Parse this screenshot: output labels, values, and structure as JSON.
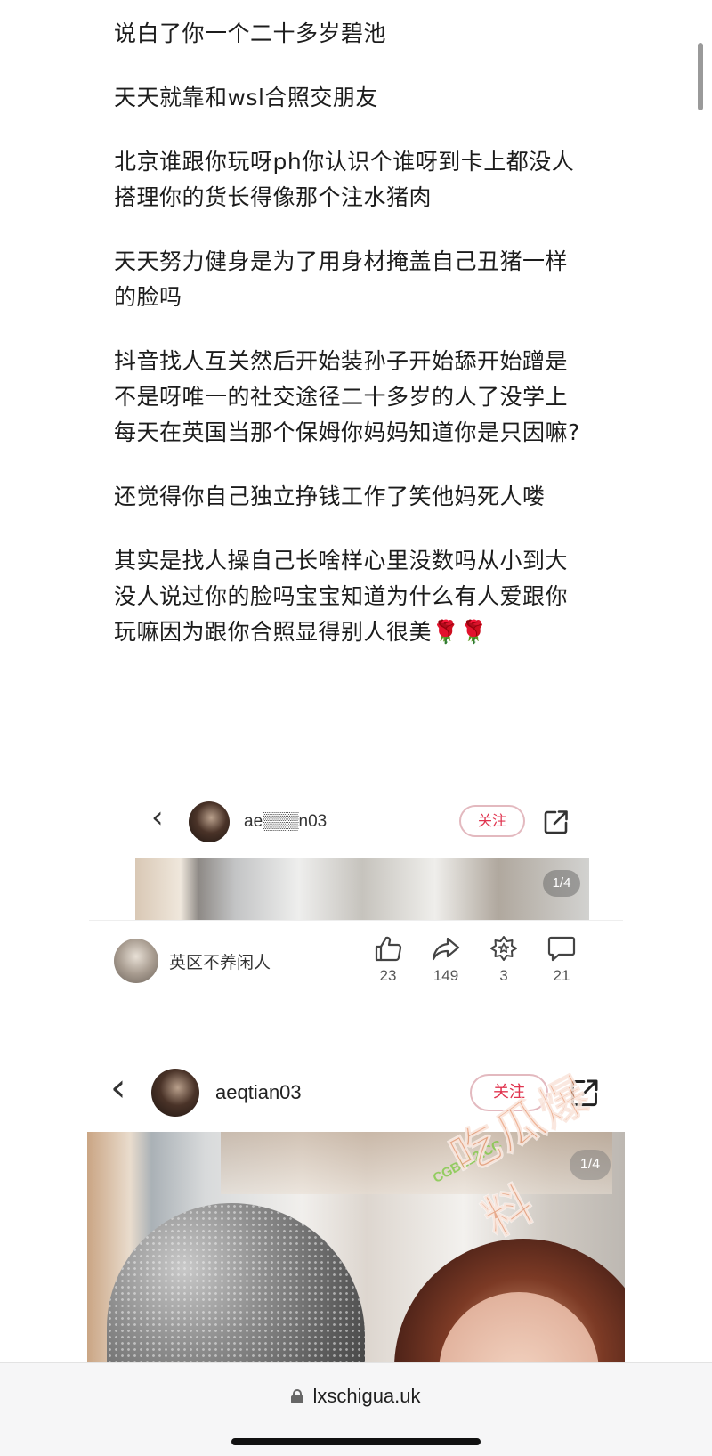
{
  "post": {
    "paragraphs": [
      "说白了你一个二十多岁碧池",
      "天天就靠和wsl合照交朋友",
      "北京谁跟你玩呀ph你认识个谁呀到卡上都没人\n搭理你的货长得像那个注水猪肉",
      "天天努力健身是为了用身材掩盖自己丑猪一样\n的脸吗",
      "抖音找人互关然后开始装孙子开始舔开始蹭是\n不是呀唯一的社交途径二十多岁的人了没学上\n每天在英国当那个保姆你妈妈知道你是只因嘛?",
      "还觉得你自己独立挣钱工作了笑他妈死人喽",
      "其实是找人操自己长啥样心里没数吗从小到大\n没人说过你的脸吗宝宝知道为什么有人爱跟你\n玩嘛因为跟你合照显得别人很美🌹🌹"
    ]
  },
  "embed_small": {
    "username": "ae▒▒▒n03",
    "follow_label": "关注",
    "photo_counter": "1/4"
  },
  "author_row": {
    "name": "英区不养闲人",
    "likes": "23",
    "shares": "149",
    "collects": "3",
    "comments": "21"
  },
  "embed_large": {
    "username": "aeqtian03",
    "follow_label": "关注",
    "photo_counter": "1/4"
  },
  "watermark": {
    "domain": "CGBL12.CC",
    "brand": "吃瓜爆料"
  },
  "browser": {
    "url": "lxschigua.uk"
  },
  "colors": {
    "follow_red": "#e0344f",
    "follow_border": "#e3b9bf",
    "bar_bg": "#f6f6f7"
  }
}
